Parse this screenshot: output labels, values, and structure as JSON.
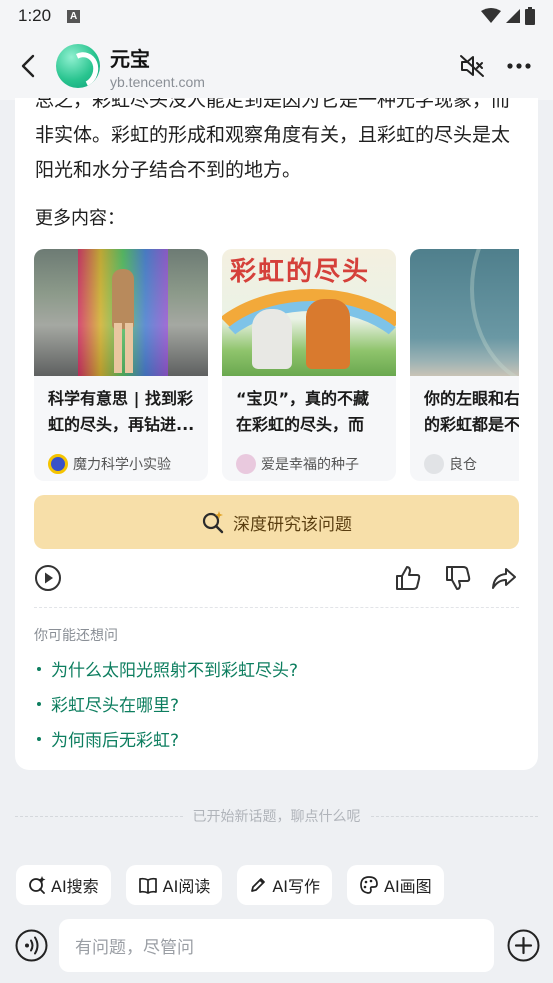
{
  "status": {
    "time": "1:20",
    "a_badge": "A"
  },
  "header": {
    "app_name": "元宝",
    "app_url": "yb.tencent.com"
  },
  "answer": {
    "paragraph": "总之，彩虹尽头没人能走到是因为它是一种光学现象，而非实体。彩虹的形成和观察角度有关，且彩虹的尽头是太阳光和水分子结合不到的地方。"
  },
  "more": {
    "label": "更多内容：",
    "cards": [
      {
        "title": "科学有意思 | 找到彩虹的尽头，再钻进...",
        "source": "魔力科学小实验"
      },
      {
        "title": "“宝贝”，真的不藏在彩虹的尽头，而藏...",
        "source": "爱是幸福的种子",
        "thumb_text": "彩虹的尽头"
      },
      {
        "title": "你的左眼和右眼看到的彩虹都是不...",
        "source": "良仓"
      }
    ]
  },
  "deep_research": {
    "label": "深度研究该问题"
  },
  "suggestions": {
    "label": "你可能还想问",
    "items": [
      "为什么太阳光照射不到彩虹尽头?",
      "彩虹尽头在哪里?",
      "为何雨后无彩虹?"
    ]
  },
  "new_topic": "已开始新话题，聊点什么呢",
  "chips": [
    {
      "label": "AI搜索",
      "icon": "search-spark-icon"
    },
    {
      "label": "AI阅读",
      "icon": "book-icon"
    },
    {
      "label": "AI写作",
      "icon": "pen-icon"
    },
    {
      "label": "AI画图",
      "icon": "palette-icon"
    }
  ],
  "input": {
    "placeholder": "有问题，尽管问"
  },
  "colors": {
    "accent_green": "#0d7e5f",
    "deep_btn_bg": "#f7dfa9"
  }
}
